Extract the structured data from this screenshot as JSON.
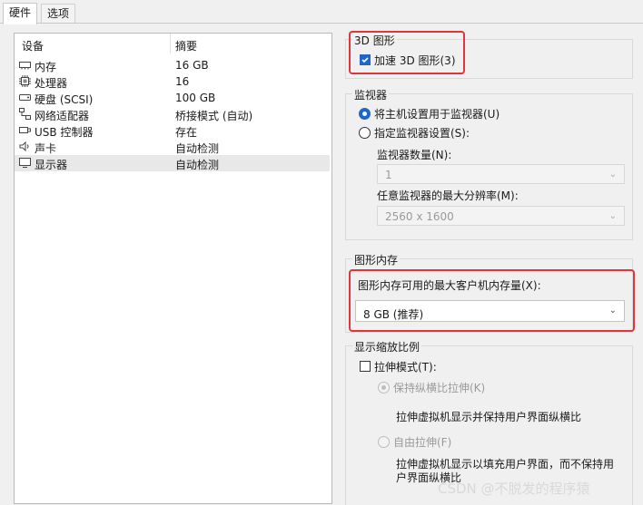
{
  "tabs": [
    {
      "label": "硬件"
    },
    {
      "label": "选项"
    }
  ],
  "device_list": {
    "headers": {
      "device": "设备",
      "summary": "摘要"
    },
    "rows": [
      {
        "device": "内存",
        "summary": "16 GB",
        "icon": "memory-icon"
      },
      {
        "device": "处理器",
        "summary": "16",
        "icon": "cpu-icon"
      },
      {
        "device": "硬盘 (SCSI)",
        "summary": "100 GB",
        "icon": "hard-disk-icon"
      },
      {
        "device": "网络适配器",
        "summary": "桥接模式 (自动)",
        "icon": "network-adapter-icon"
      },
      {
        "device": "USB 控制器",
        "summary": "存在",
        "icon": "usb-icon"
      },
      {
        "device": "声卡",
        "summary": "自动检测",
        "icon": "speaker-icon"
      },
      {
        "device": "显示器",
        "summary": "自动检测",
        "icon": "monitor-icon",
        "selected": true
      }
    ]
  },
  "graphics3d": {
    "title": "3D 图形",
    "accelerate_label": "加速 3D 图形(3)",
    "accelerate_checked": true
  },
  "monitor": {
    "title": "监视器",
    "host_setting_label": "将主机设置用于监视器(U)",
    "host_setting_selected": true,
    "specify_label": "指定监视器设置(S):",
    "count_label": "监视器数量(N):",
    "count_value": "1",
    "max_res_label": "任意监视器的最大分辨率(M):",
    "max_res_value": "2560 x 1600"
  },
  "graphics_memory": {
    "title": "图形内存",
    "label": "图形内存可用的最大客户机内存量(X):",
    "value": "8 GB (推荐)"
  },
  "scaling": {
    "title": "显示缩放比例",
    "stretch_label": "拉伸模式(T):",
    "stretch_checked": false,
    "keep_aspect_label": "保持纵横比拉伸(K)",
    "keep_aspect_desc": "拉伸虚拟机显示并保持用户界面纵横比",
    "free_label": "自由拉伸(F)",
    "free_desc_line1": "拉伸虚拟机显示以填充用户界面，而不保持用",
    "free_desc_line2": "户界面纵横比"
  },
  "watermark": "CSDN @不脱发的程序猿",
  "colors": {
    "accent": "#1e66c8",
    "highlight": "#e0353b"
  }
}
